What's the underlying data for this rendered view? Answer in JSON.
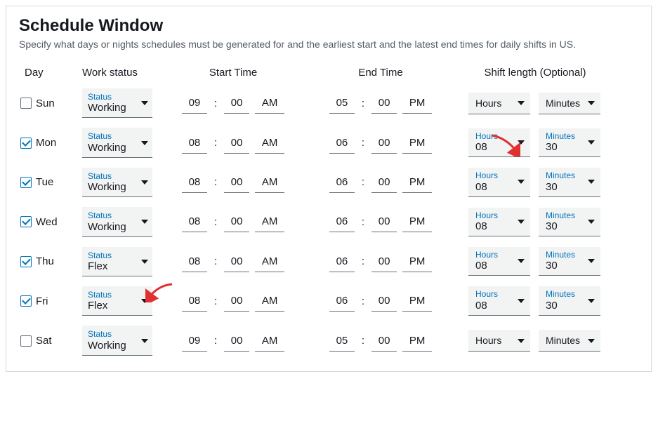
{
  "title": "Schedule Window",
  "subtitle": "Specify what days or nights schedules must be generated for and the earliest start and the latest end times for daily shifts in US.",
  "headers": {
    "day": "Day",
    "workStatus": "Work status",
    "startTime": "Start Time",
    "endTime": "End Time",
    "shiftLength": "Shift length (Optional)"
  },
  "labels": {
    "status": "Status",
    "hours": "Hours",
    "minutes": "Minutes"
  },
  "rows": [
    {
      "day": "Sun",
      "checked": false,
      "status": "Working",
      "start": {
        "hh": "09",
        "mm": "00",
        "ap": "AM"
      },
      "end": {
        "hh": "05",
        "mm": "00",
        "ap": "PM"
      },
      "shift": {
        "hours": "",
        "minutes": ""
      }
    },
    {
      "day": "Mon",
      "checked": true,
      "status": "Working",
      "start": {
        "hh": "08",
        "mm": "00",
        "ap": "AM"
      },
      "end": {
        "hh": "06",
        "mm": "00",
        "ap": "PM"
      },
      "shift": {
        "hours": "08",
        "minutes": "30"
      }
    },
    {
      "day": "Tue",
      "checked": true,
      "status": "Working",
      "start": {
        "hh": "08",
        "mm": "00",
        "ap": "AM"
      },
      "end": {
        "hh": "06",
        "mm": "00",
        "ap": "PM"
      },
      "shift": {
        "hours": "08",
        "minutes": "30"
      }
    },
    {
      "day": "Wed",
      "checked": true,
      "status": "Working",
      "start": {
        "hh": "08",
        "mm": "00",
        "ap": "AM"
      },
      "end": {
        "hh": "06",
        "mm": "00",
        "ap": "PM"
      },
      "shift": {
        "hours": "08",
        "minutes": "30"
      }
    },
    {
      "day": "Thu",
      "checked": true,
      "status": "Flex",
      "start": {
        "hh": "08",
        "mm": "00",
        "ap": "AM"
      },
      "end": {
        "hh": "06",
        "mm": "00",
        "ap": "PM"
      },
      "shift": {
        "hours": "08",
        "minutes": "30"
      }
    },
    {
      "day": "Fri",
      "checked": true,
      "status": "Flex",
      "start": {
        "hh": "08",
        "mm": "00",
        "ap": "AM"
      },
      "end": {
        "hh": "06",
        "mm": "00",
        "ap": "PM"
      },
      "shift": {
        "hours": "08",
        "minutes": "30"
      }
    },
    {
      "day": "Sat",
      "checked": false,
      "status": "Working",
      "start": {
        "hh": "09",
        "mm": "00",
        "ap": "AM"
      },
      "end": {
        "hh": "05",
        "mm": "00",
        "ap": "PM"
      },
      "shift": {
        "hours": "",
        "minutes": ""
      }
    }
  ],
  "colors": {
    "accent": "#0073bb",
    "arrow": "#e03030"
  }
}
